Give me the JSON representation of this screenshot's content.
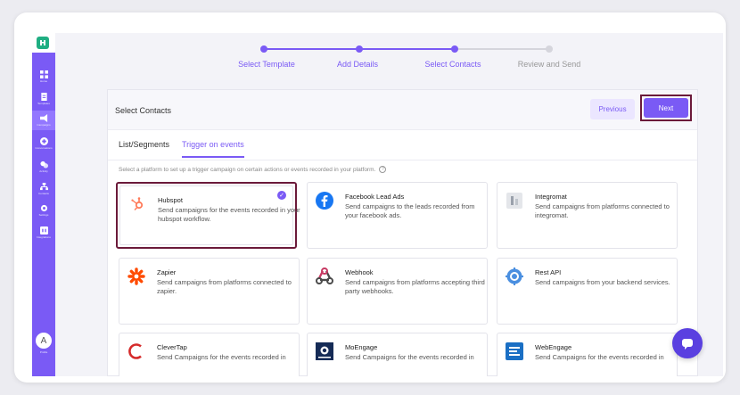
{
  "sidebar": {
    "items": [
      {
        "label": "Home",
        "icon": "grid-icon"
      },
      {
        "label": "Templates",
        "icon": "document-icon"
      },
      {
        "label": "Campaigns",
        "icon": "megaphone-icon"
      },
      {
        "label": "Conversations",
        "icon": "chat-icon"
      },
      {
        "label": "Activity",
        "icon": "activity-icon"
      },
      {
        "label": "Contacts",
        "icon": "contacts-icon"
      },
      {
        "label": "Settings",
        "icon": "gear-icon"
      },
      {
        "label": "Integrations",
        "icon": "integrations-icon"
      }
    ],
    "avatar_initial": "A",
    "avatar_label": "Profile"
  },
  "stepper": {
    "steps": [
      {
        "label": "Select Template",
        "state": "done"
      },
      {
        "label": "Add Details",
        "state": "done"
      },
      {
        "label": "Select Contacts",
        "state": "current"
      },
      {
        "label": "Review and Send",
        "state": "pending"
      }
    ],
    "active_color": "#7a5af5",
    "pending_color": "#d5d5dc"
  },
  "card": {
    "title": "Select Contacts",
    "previous_label": "Previous",
    "next_label": "Next"
  },
  "tabs": [
    {
      "label": "List/Segments",
      "active": false
    },
    {
      "label": "Trigger on events",
      "active": true
    }
  ],
  "hint": "Select a platform to set up a trigger campaign on certain actions or events recorded in your platform.",
  "help_icon": "?",
  "platforms": [
    {
      "name": "Hubspot",
      "desc": "Send campaigns for the events recorded in your hubspot workflow.",
      "icon": "hubspot-icon",
      "selected": true
    },
    {
      "name": "Facebook Lead Ads",
      "desc": "Send campaigns to the leads recorded from your facebook ads.",
      "icon": "facebook-icon"
    },
    {
      "name": "Integromat",
      "desc": "Send campaigns from platforms connected to integromat.",
      "icon": "integromat-icon"
    },
    {
      "name": "Zapier",
      "desc": "Send campaigns from platforms connected to zapier.",
      "icon": "zapier-icon"
    },
    {
      "name": "Webhook",
      "desc": "Send campaigns from platforms accepting third party webhooks.",
      "icon": "webhook-icon"
    },
    {
      "name": "Rest API",
      "desc": "Send campaigns from your backend services.",
      "icon": "rest-api-icon"
    },
    {
      "name": "CleverTap",
      "desc": "Send Campaigns for the events recorded in",
      "icon": "clevertap-icon"
    },
    {
      "name": "MoEngage",
      "desc": "Send Campaigns for the events recorded in",
      "icon": "moengage-icon"
    },
    {
      "name": "WebEngage",
      "desc": "Send Campaigns for the events recorded in",
      "icon": "webengage-icon"
    }
  ],
  "colors": {
    "brand": "#7a5af5",
    "highlight_outline": "#6b1a3a",
    "logo": "#1fae82",
    "chat": "#5a40e0"
  }
}
